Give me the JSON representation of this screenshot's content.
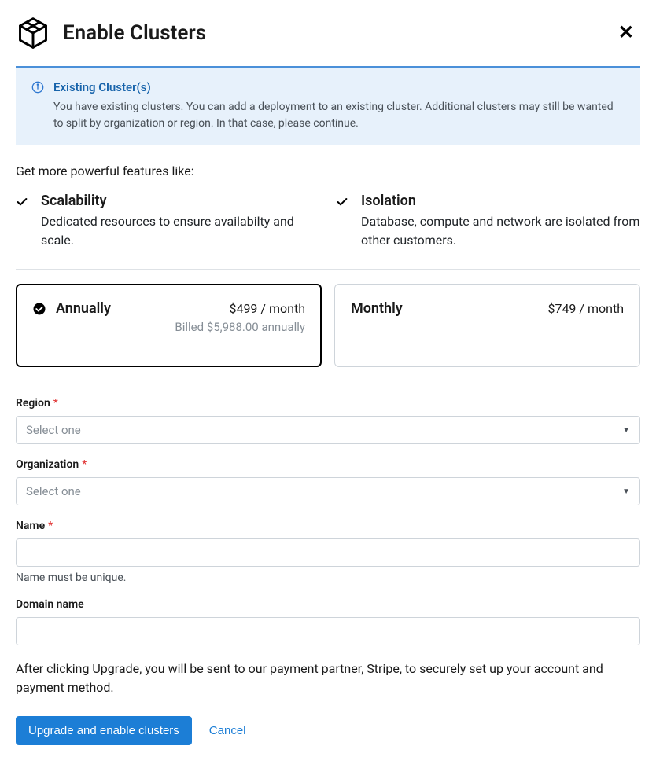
{
  "header": {
    "title": "Enable Clusters"
  },
  "alert": {
    "title": "Existing Cluster(s)",
    "body": "You have existing clusters. You can add a deployment to an existing cluster. Additional clusters may still be wanted to split by organization or region. In that case, please continue."
  },
  "intro": "Get more powerful features like:",
  "features": [
    {
      "title": "Scalability",
      "desc": "Dedicated resources to ensure availabilty and scale."
    },
    {
      "title": "Isolation",
      "desc": "Database, compute and network are isolated from other customers."
    }
  ],
  "pricing": {
    "annually": {
      "name": "Annually",
      "price": "$499 / month",
      "sub": "Billed $5,988.00 annually",
      "selected": true
    },
    "monthly": {
      "name": "Monthly",
      "price": "$749 / month",
      "selected": false
    }
  },
  "form": {
    "region": {
      "label": "Region",
      "placeholder": "Select one"
    },
    "organization": {
      "label": "Organization",
      "placeholder": "Select one"
    },
    "name": {
      "label": "Name",
      "helper": "Name must be unique."
    },
    "domain": {
      "label": "Domain name"
    }
  },
  "footer_note": "After clicking Upgrade, you will be sent to our payment partner, Stripe, to securely set up your account and payment method.",
  "actions": {
    "primary": "Upgrade and enable clusters",
    "cancel": "Cancel"
  }
}
